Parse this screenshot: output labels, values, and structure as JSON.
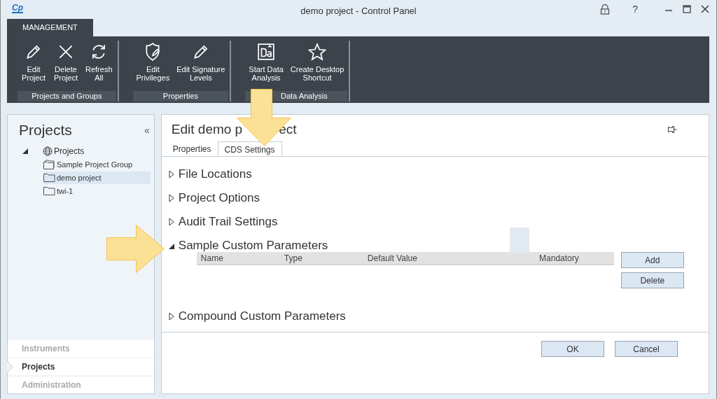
{
  "window": {
    "logo": "Cp",
    "title": "demo project - Control Panel",
    "help": "?"
  },
  "ribbon": {
    "tab": {
      "label": "MANAGEMENT",
      "selected": true
    },
    "groups": [
      {
        "label": "Projects and Groups",
        "buttons": [
          {
            "label": "Edit Project",
            "kind": "pencil"
          },
          {
            "label": "Delete Project",
            "kind": "cross"
          },
          {
            "label": "Refresh All",
            "kind": "refresh"
          }
        ]
      },
      {
        "label": "Properties",
        "buttons": [
          {
            "label": "Edit Privileges",
            "kind": "shield"
          },
          {
            "label": "Edit Signature Levels",
            "kind": "pencil"
          }
        ]
      },
      {
        "label": "Data Analysis",
        "buttons": [
          {
            "label": "Start Data Analysis",
            "kind": "analysis"
          },
          {
            "label": "Create Desktop Shortcut",
            "kind": "star"
          }
        ]
      }
    ]
  },
  "sidebar": {
    "title": "Projects",
    "collapse": "«",
    "tree": [
      {
        "label": "Projects",
        "kind": "root",
        "expanded": true,
        "selected": false,
        "children": [
          {
            "label": "Sample Project Group",
            "kind": "group",
            "selected": false
          },
          {
            "label": "demo project",
            "kind": "project",
            "selected": true
          },
          {
            "label": "twi-1",
            "kind": "project",
            "selected": false
          }
        ]
      }
    ],
    "nav": [
      {
        "label": "Instruments",
        "selected": false
      },
      {
        "label": "Projects",
        "selected": true
      },
      {
        "label": "Administration",
        "selected": false
      }
    ]
  },
  "editor": {
    "title": "Edit demo p",
    "title_end": "ect",
    "tabs": [
      {
        "label": "Properties",
        "selected": false
      },
      {
        "label": "CDS Settings",
        "selected": true
      }
    ],
    "sections": [
      {
        "label": "File Locations",
        "expanded": false
      },
      {
        "label": "Project Options",
        "expanded": false
      },
      {
        "label": "Audit Trail Settings",
        "expanded": false
      },
      {
        "label": "Sample Custom Parameters",
        "expanded": true,
        "table": {
          "columns": [
            "Name",
            "Type",
            "Default Value",
            "Mandatory"
          ],
          "buttons": [
            "Add",
            "Delete"
          ]
        }
      },
      {
        "label": "Compound Custom Parameters",
        "expanded": false
      }
    ],
    "buttons": [
      "OK",
      "Cancel"
    ]
  },
  "callouts": [
    {
      "kind": "down"
    },
    {
      "kind": "right"
    }
  ]
}
